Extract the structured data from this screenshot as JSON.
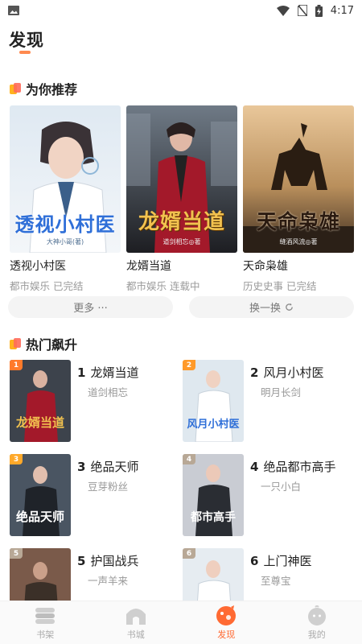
{
  "status_bar": {
    "time": "4:17"
  },
  "page": {
    "title": "发现"
  },
  "recommend": {
    "title": "为你推荐",
    "books": [
      {
        "title": "透视小村医",
        "meta": "都市娱乐 已完结",
        "cover_text": "透视小村医",
        "cover_sub": "大神小哥(著)"
      },
      {
        "title": "龙婿当道",
        "meta": "都市娱乐 连载中",
        "cover_text": "龙婿当道",
        "cover_sub": "道剑相忘◎著"
      },
      {
        "title": "天命枭雄",
        "meta": "历史史事 已完结",
        "cover_text": "天命枭雄",
        "cover_sub": "缝酒风流◎著"
      }
    ],
    "more_label": "更多 ···",
    "refresh_label": "换一换"
  },
  "hot": {
    "title": "热门飙升",
    "items": [
      {
        "rank": "1",
        "num": "1",
        "title": "龙婿当道",
        "author": "道剑相忘",
        "cover_text": "龙婿当道",
        "badge_color": "#ff7a2a"
      },
      {
        "rank": "2",
        "num": "2",
        "title": "风月小村医",
        "author": "明月长剑",
        "cover_text": "风月小村医",
        "badge_color": "#ff9a2a"
      },
      {
        "rank": "3",
        "num": "3",
        "title": "绝品天师",
        "author": "豆芽粉丝",
        "cover_text": "绝品天师",
        "badge_color": "#ffa92a"
      },
      {
        "rank": "4",
        "num": "4",
        "title": "绝品都市高手",
        "author": "一只小白",
        "cover_text": "都市高手",
        "badge_color": "#b8a896"
      },
      {
        "rank": "5",
        "num": "5",
        "title": "护国战兵",
        "author": "一声羊来",
        "cover_text": "",
        "badge_color": "#b8a896"
      },
      {
        "rank": "6",
        "num": "6",
        "title": "上门神医",
        "author": "至尊宝",
        "cover_text": "",
        "badge_color": "#b8a896"
      }
    ]
  },
  "nav": {
    "items": [
      {
        "label": "书架"
      },
      {
        "label": "书城"
      },
      {
        "label": "发现"
      },
      {
        "label": "我的"
      }
    ]
  }
}
